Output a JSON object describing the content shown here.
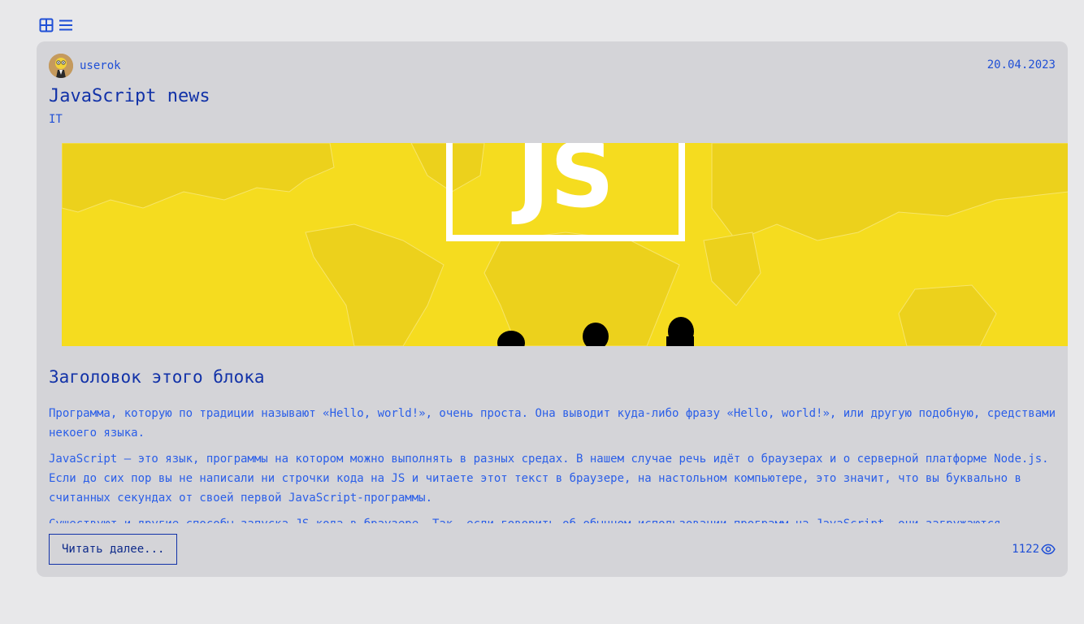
{
  "post": {
    "author": "userok",
    "date": "20.04.2023",
    "title": "JavaScript news",
    "category": "IT",
    "block_title": "Заголовок этого блока",
    "paragraphs": [
      "Программа, которую по традиции называют «Hello, world!», очень проста. Она выводит куда-либо фразу «Hello, world!», или другую подобную, средствами некоего языка.",
      "JavaScript — это язык, программы на котором можно выполнять в разных средах. В нашем случае речь идёт о браузерах и о серверной платформе Node.js. Если до сих пор вы не написали ни строчки кода на JS и читаете этот текст в браузере, на настольном компьютере, это значит, что вы буквально в считанных секундах от своей первой JavaScript-программы.",
      "Существуют и другие способы запуска JS-кода в браузере. Так, если говорить об обычном использовании программ на JavaScript, они загружаются"
    ],
    "read_more_label": "Читать далее...",
    "views": "1122"
  },
  "hero": {
    "logo_text": "JS"
  },
  "icons": {
    "grid_view": "grid-icon",
    "list_view": "list-icon",
    "views": "eye-icon"
  },
  "colors": {
    "accent": "#1f4fd6",
    "title": "#1232a8",
    "card_bg": "#d4d4d8",
    "page_bg": "#e8e8ea",
    "hero_yellow": "#f5dc1f"
  }
}
